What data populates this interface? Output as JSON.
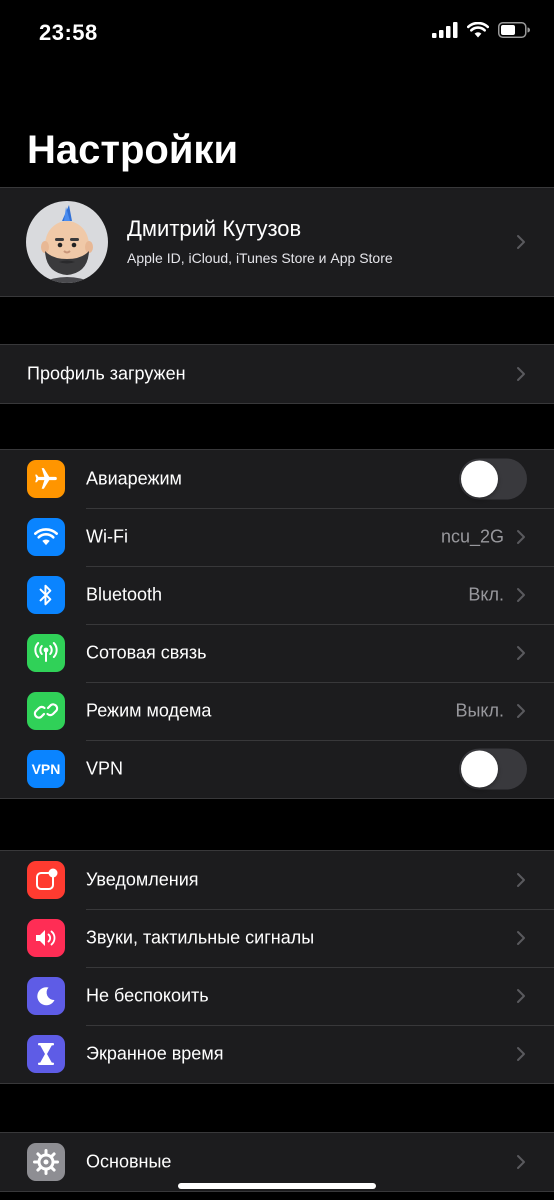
{
  "status": {
    "time": "23:58"
  },
  "title": "Настройки",
  "profile": {
    "name": "Дмитрий Кутузов",
    "subtitle": "Apple ID, iCloud, iTunes Store и App Store"
  },
  "profile_loaded": {
    "label": "Профиль загружен"
  },
  "connectivity": {
    "airplane": {
      "label": "Авиарежим",
      "on": false,
      "icon": "airplane-icon",
      "color": "#ff9500"
    },
    "wifi": {
      "label": "Wi-Fi",
      "value": "ncu_2G",
      "icon": "wifi-icon",
      "color": "#0a84ff"
    },
    "bluetooth": {
      "label": "Bluetooth",
      "value": "Вкл.",
      "icon": "bluetooth-icon",
      "color": "#0a84ff"
    },
    "cellular": {
      "label": "Сотовая связь",
      "icon": "cellular-icon",
      "color": "#30d158"
    },
    "hotspot": {
      "label": "Режим модема",
      "value": "Выкл.",
      "icon": "hotspot-icon",
      "color": "#30d158"
    },
    "vpn": {
      "label": "VPN",
      "icon_text": "VPN",
      "on": false,
      "icon": "vpn-icon",
      "color": "#0a84ff"
    }
  },
  "notifications_group": {
    "notifications": {
      "label": "Уведомления",
      "icon": "notifications-icon",
      "color": "#ff3b30"
    },
    "sounds": {
      "label": "Звуки, тактильные сигналы",
      "icon": "sounds-icon",
      "color": "#ff2d55"
    },
    "dnd": {
      "label": "Не беспокоить",
      "icon": "moon-icon",
      "color": "#5e5ce6"
    },
    "screen_time": {
      "label": "Экранное время",
      "icon": "hourglass-icon",
      "color": "#5e5ce6"
    }
  },
  "general_group": {
    "general": {
      "label": "Основные",
      "icon": "gear-icon",
      "color": "#8e8e93"
    }
  }
}
